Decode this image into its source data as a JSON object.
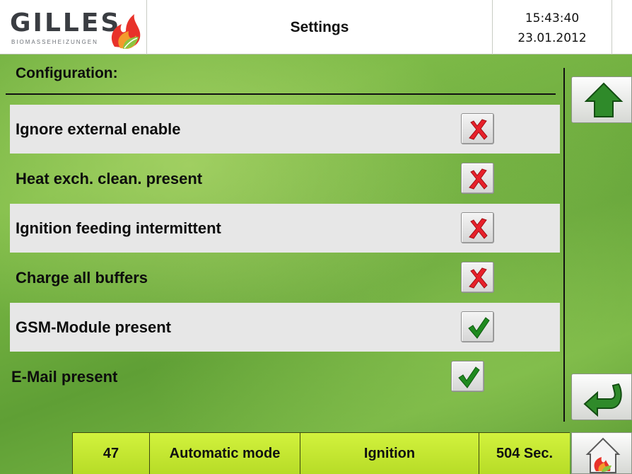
{
  "header": {
    "logo_text": "GILLES",
    "logo_subtitle": "BIOMASSEHEIZUNGEN",
    "title": "Settings",
    "time": "15:43:40",
    "date": "23.01.2012"
  },
  "config": {
    "title": "Configuration:",
    "options": [
      {
        "label": "Ignore external enable",
        "enabled": false
      },
      {
        "label": "Heat exch. clean. present",
        "enabled": false
      },
      {
        "label": "Ignition feeding intermittent",
        "enabled": false
      },
      {
        "label": "Charge all buffers",
        "enabled": false
      },
      {
        "label": "GSM-Module present",
        "enabled": true
      },
      {
        "label": "E-Mail present",
        "enabled": true
      }
    ]
  },
  "nav": {
    "up_icon": "arrow-up-icon",
    "back_icon": "arrow-return-icon",
    "home_icon": "home-flame-icon"
  },
  "status_bar": {
    "number": "47",
    "mode": "Automatic mode",
    "phase": "Ignition",
    "timer": "504 Sec."
  },
  "colors": {
    "status_green": "#c6e832",
    "check_green": "#1f8a1f",
    "cross_red": "#e8202a",
    "arrow_green": "#2f8a2a"
  }
}
